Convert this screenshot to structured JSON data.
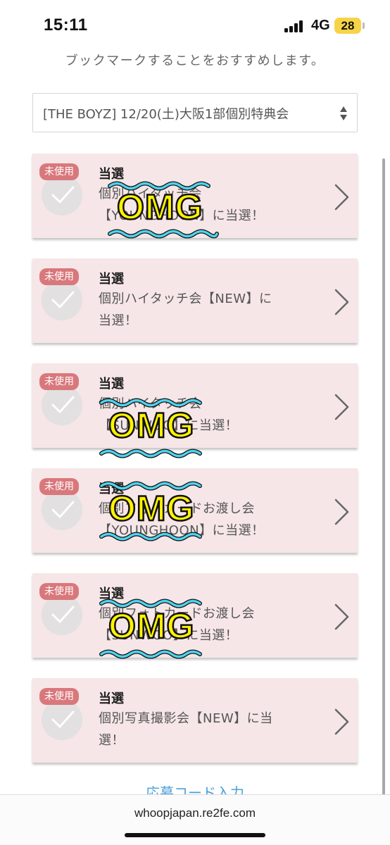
{
  "status_bar": {
    "time": "15:11",
    "network": "4G",
    "battery": "28",
    "battery_color": "#f7d347"
  },
  "bookmark_note": "ブックマークすることをおすすめします。",
  "event_select": {
    "selected": "[THE BOYZ] 12/20(土)大阪1部個別特典会",
    "icon": "sort-arrows-icon"
  },
  "cards": [
    {
      "badge": "未使用",
      "title": "当選",
      "line1": "個別ハイタッチ会",
      "line2": "【YOUNGHOON】に当選！",
      "sticker": "OMG"
    },
    {
      "badge": "未使用",
      "title": "当選",
      "line1": "個別ハイタッチ会【NEW】に",
      "line2": "当選！",
      "sticker": ""
    },
    {
      "badge": "未使用",
      "title": "当選",
      "line1": "個別ハイタッチ会",
      "line2": "【SUNWOO】に当選！",
      "sticker": "OMG"
    },
    {
      "badge": "未使用",
      "title": "当選",
      "line1": "個別フォトカードお渡し会",
      "line2": "【YOUNGHOON】に当選！",
      "sticker": "OMG"
    },
    {
      "badge": "未使用",
      "title": "当選",
      "line1": "個別フォトカードお渡し会",
      "line2": "【SUNWOO】に当選！",
      "sticker": "OMG"
    },
    {
      "badge": "未使用",
      "title": "当選",
      "line1": "個別写真撮影会【NEW】に当",
      "line2": "選！",
      "sticker": ""
    }
  ],
  "apply_code_link": "応募コード入力",
  "browser": {
    "url": "whoopjapan.re2fe.com"
  },
  "colors": {
    "card_bg": "#f6e6e7",
    "badge_bg": "#d9787c",
    "sticker_text": "#fff200",
    "sticker_wave": "#4fd3ee",
    "link": "#4a9fd8"
  }
}
